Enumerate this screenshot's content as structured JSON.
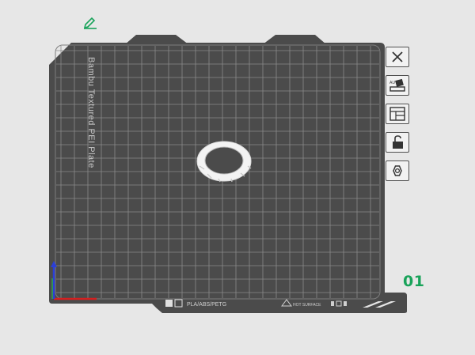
{
  "plate": {
    "name": "Bambu Textured PEI Plate",
    "number": "01",
    "filament_label": "PLA/ABS/PETG",
    "hot_surface_label": "HOT SURFACE"
  },
  "toolbar": {
    "tools": [
      {
        "name": "close-icon"
      },
      {
        "name": "auto-orient-icon"
      },
      {
        "name": "arrange-icon"
      },
      {
        "name": "lock-icon"
      },
      {
        "name": "settings-icon"
      }
    ]
  },
  "colors": {
    "background": "#e7e7e7",
    "plate": "#4b4b4b",
    "grid": "#8a8a8a",
    "accent_green": "#19a35a",
    "axis_x": "#d42020",
    "axis_y": "#2fa84a",
    "axis_z": "#2b3fd8"
  }
}
